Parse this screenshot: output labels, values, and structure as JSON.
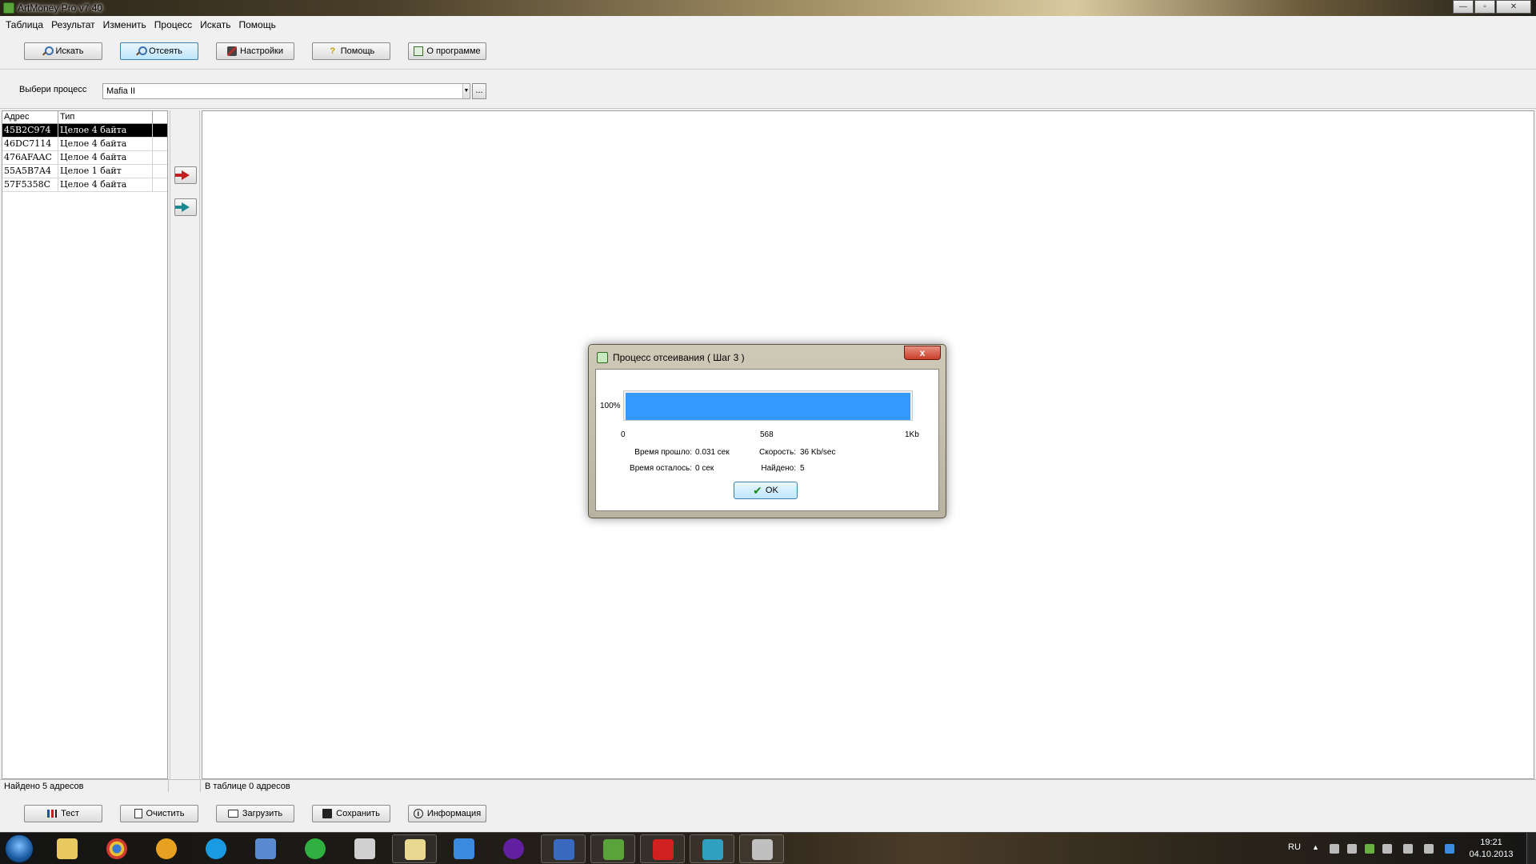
{
  "window": {
    "title": "ArtMoney Pro v7.40",
    "controls": {
      "minimize": "—",
      "maximize": "▫",
      "close": "✕"
    }
  },
  "menu": [
    "Таблица",
    "Результат",
    "Изменить",
    "Процесс",
    "Искать",
    "Помощь"
  ],
  "toolbar": {
    "search": "Искать",
    "filter": "Отсеять",
    "settings": "Настройки",
    "help": "Помощь",
    "about": "О программе"
  },
  "process": {
    "label": "Выбери процесс",
    "selected": "Mafia II",
    "browse": "..."
  },
  "table": {
    "headers": {
      "address": "Адрес",
      "type": "Тип"
    },
    "rows": [
      {
        "address": "45B2C974",
        "type": "Целое 4 байта"
      },
      {
        "address": "46DC7114",
        "type": "Целое 4 байта"
      },
      {
        "address": "476AFAAC",
        "type": "Целое 4 байта"
      },
      {
        "address": "55A5B7A4",
        "type": "Целое 1 байт"
      },
      {
        "address": "57F5358C",
        "type": "Целое 4 байта"
      }
    ]
  },
  "status": {
    "left": "Найдено 5 адресов",
    "right": "В таблице 0 адресов"
  },
  "bottom_buttons": {
    "test": "Тест",
    "clear": "Очистить",
    "load": "Загрузить",
    "save": "Сохранить",
    "info": "Информация"
  },
  "dialog": {
    "title": "Процесс отсеивания ( Шаг 3 )",
    "close": "x",
    "percent": "100%",
    "progress": 1.0,
    "ticks": {
      "start": "0",
      "mid": "568",
      "end": "1Kb"
    },
    "elapsed_label": "Время прошло:",
    "elapsed_value": "0.031 сек",
    "remaining_label": "Время осталось:",
    "remaining_value": "0 сек",
    "speed_label": "Скорость:",
    "speed_value": "36 Kb/sec",
    "found_label": "Найдено:",
    "found_value": "5",
    "ok": "OK"
  },
  "taskbar": {
    "lang": "RU",
    "time": "19:21",
    "date": "04.10.2013",
    "apps": [
      "explorer",
      "chrome",
      "aimp",
      "skype",
      "downloads",
      "mail-agent",
      "paint",
      "folder",
      "dropbox",
      "media-player",
      "word",
      "artmoney",
      "opera",
      "games",
      "calc"
    ]
  },
  "colors": {
    "progress": "#3399ff",
    "selection": "#000000"
  }
}
